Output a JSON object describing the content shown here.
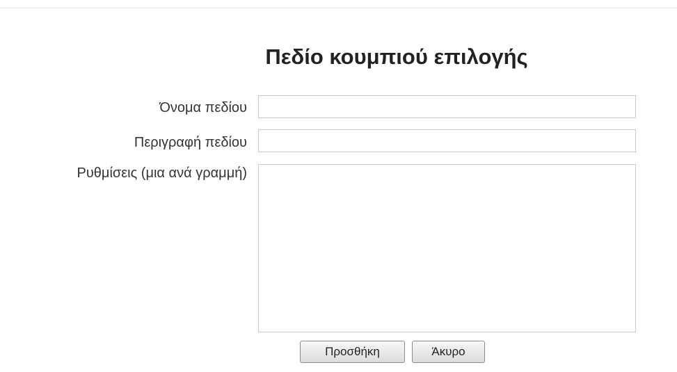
{
  "form": {
    "title": "Πεδίο κουμπιού επιλογής",
    "fields": {
      "name": {
        "label": "Όνομα πεδίου",
        "value": ""
      },
      "description": {
        "label": "Περιγραφή πεδίου",
        "value": ""
      },
      "options": {
        "label": "Ρυθμίσεις (μια ανά γραμμή)",
        "value": ""
      }
    },
    "buttons": {
      "add": "Προσθήκη",
      "cancel": "Άκυρο"
    }
  }
}
